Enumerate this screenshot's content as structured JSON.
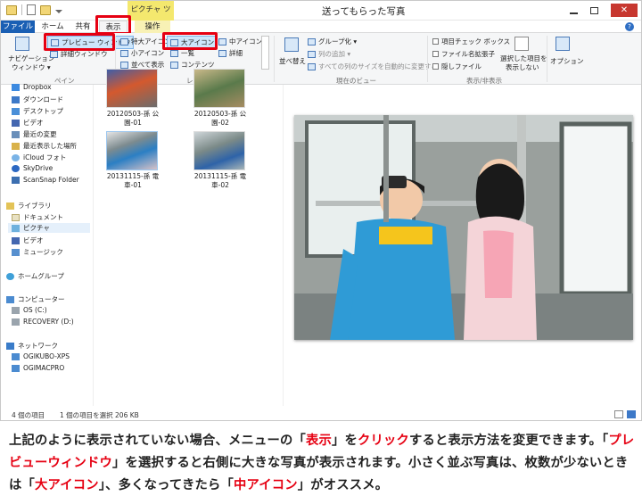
{
  "window": {
    "title": "送ってもらった写真",
    "context_tools": "ピクチャ ツール",
    "close_glyph": "✕"
  },
  "tabs": {
    "file": "ファイル",
    "home": "ホーム",
    "share": "共有",
    "view": "表示",
    "manage": "操作",
    "help": "?"
  },
  "ribbon": {
    "pane": {
      "nav_pane_1": "ナビゲーション",
      "nav_pane_2": "ウィンドウ ▾",
      "preview": "プレビュー ウィンドウ",
      "details": "詳細ウィンドウ",
      "group_label": "ペイン"
    },
    "layout": {
      "extra_large": "特大アイコン",
      "large": "大アイコン",
      "medium": "中アイコン",
      "small": "小アイコン",
      "list": "一覧",
      "detail": "詳細",
      "tiles": "並べて表示",
      "content": "コンテンツ",
      "group_label": "レイアウト"
    },
    "current_view": {
      "sort_by": "並べ替え",
      "group_by": "グループ化 ▾",
      "add_columns": "列の追加 ▾",
      "size_all_columns": "すべての列のサイズを自動的に変更する",
      "group_label": "現在のビュー"
    },
    "show_hide": {
      "item_checkboxes": "項目チェック ボックス",
      "file_extensions": "ファイル名拡張子",
      "hidden_items": "隠しファイル",
      "hide_selected_1": "選択した項目を",
      "hide_selected_2": "表示しない",
      "group_label": "表示/非表示"
    },
    "options": "オプション"
  },
  "nav": {
    "dropbox": "Dropbox",
    "downloads": "ダウンロード",
    "desktop": "デスクトップ",
    "videos": "ビデオ",
    "recent": "最近の変更",
    "recent_places": "最近表示した場所",
    "icloud": "iCloud フォト",
    "skydrive": "SkyDrive",
    "scansnap": "ScanSnap Folder",
    "libraries": "ライブラリ",
    "documents": "ドキュメント",
    "pictures": "ピクチャ",
    "lib_videos": "ビデオ",
    "music": "ミュージック",
    "homegroup": "ホームグループ",
    "computer": "コンピューター",
    "os_c": "OS (C:)",
    "recovery_d": "RECOVERY (D:)",
    "network": "ネットワーク",
    "pc1": "OGIKUBO-XPS",
    "pc2": "OGIMACPRO"
  },
  "files": [
    {
      "name_1": "20120503-孫 公",
      "name_2": "園-01"
    },
    {
      "name_1": "20120503-孫 公",
      "name_2": "園-02"
    },
    {
      "name_1": "20131115-孫 電",
      "name_2": "車-01"
    },
    {
      "name_1": "20131115-孫 電",
      "name_2": "車-02"
    }
  ],
  "status": {
    "count": "4 個の項目",
    "selected": "1 個の項目を選択  206 KB"
  },
  "caption": {
    "p1": "上記のように表示されていない場合、メニューの「",
    "r1": "表示",
    "p2": "」を",
    "r2": "クリック",
    "p3": "すると表示方法を変更できます。「",
    "r3": "プレビューウィンドウ",
    "p4": "」を選択すると右側に大きな写真が表示されます。小さく並ぶ写真は、枚数が少ないときは「",
    "r4": "大アイコン",
    "p5": "」、多くなってきたら「",
    "r5": "中アイコン",
    "p6": "」がオススメ。"
  },
  "colors": {
    "accent_red": "#e60012",
    "file_tab_blue": "#1a5fb4",
    "tools_yellow": "#f4e86e"
  }
}
